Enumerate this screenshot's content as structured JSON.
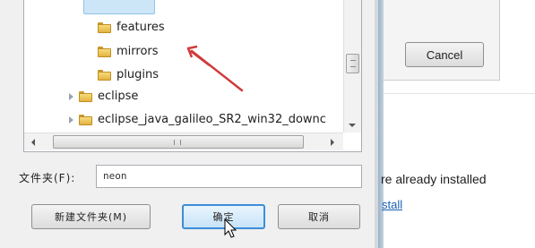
{
  "folder_tree": {
    "items": [
      {
        "label": "features",
        "expandable": false
      },
      {
        "label": "mirrors",
        "expandable": false
      },
      {
        "label": "plugins",
        "expandable": false
      },
      {
        "label": "eclipse",
        "expandable": true
      },
      {
        "label": "eclipse_java_galileo_SR2_win32_downc",
        "expandable": true
      }
    ]
  },
  "folder_field": {
    "label": "文件夹(F):",
    "value": "neon"
  },
  "buttons": {
    "new_folder": "新建文件夹(M)",
    "ok": "确定",
    "cancel": "取消"
  },
  "background_dialog": {
    "cancel_label": "Cancel",
    "status_text": "re already installed",
    "link_text": "stall"
  },
  "colors": {
    "annotation_arrow": "#d03a3a",
    "selection_highlight": "#cde6f7",
    "link": "#1a5fb4"
  }
}
